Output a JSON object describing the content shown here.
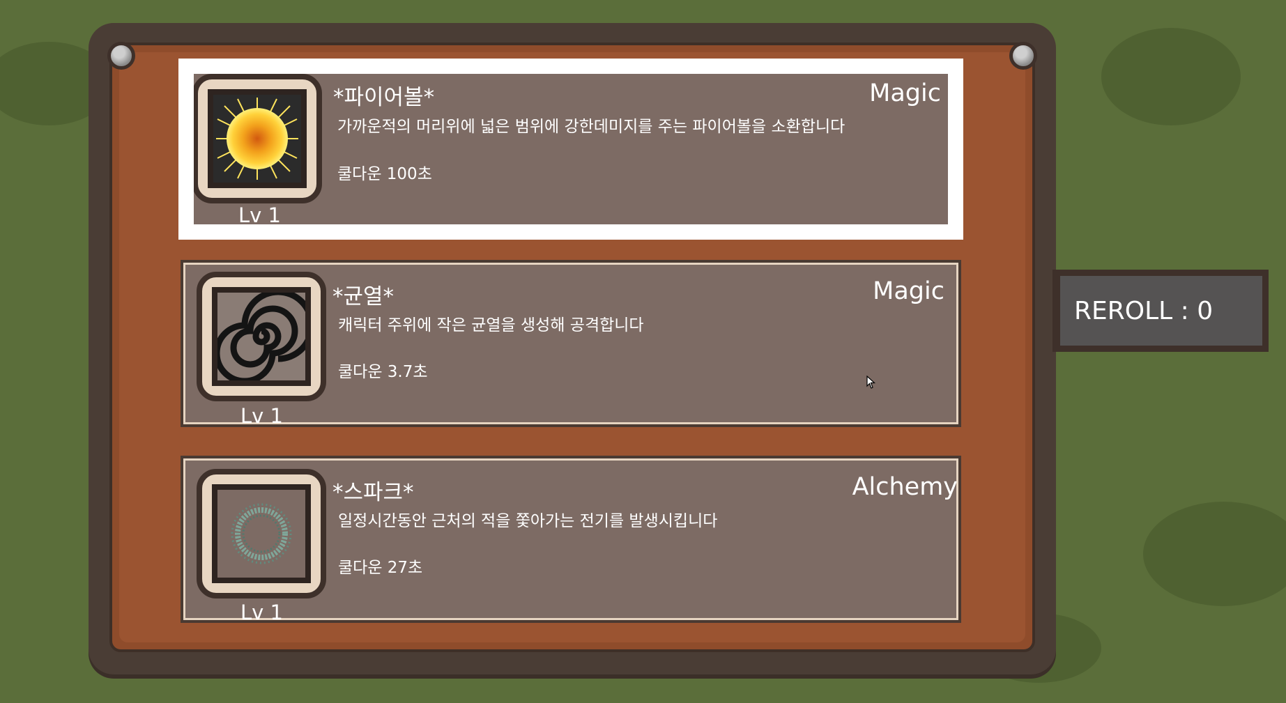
{
  "skills": [
    {
      "name": "*파이어볼*",
      "category": "Magic",
      "description": "가까운적의 머리위에 넓은 범위에 강한데미지를 주는 파이어볼을 소환합니다",
      "cooldown": "쿨다운 100초",
      "level": "Lv 1",
      "icon": "fireball-icon",
      "selected": true
    },
    {
      "name": "*균열*",
      "category": "Magic",
      "description": "캐릭터 주위에 작은 균열을 생성해 공격합니다",
      "cooldown": "쿨다운  3.7초",
      "level": "Lv 1",
      "icon": "spiral-rift-icon",
      "selected": false
    },
    {
      "name": "*스파크*",
      "category": "Alchemy",
      "description": "일정시간동안 근처의 적을 쫓아가는 전기를 발생시킵니다",
      "cooldown": "쿨다운  27초",
      "level": "Lv 1",
      "icon": "spark-ring-icon",
      "selected": false
    }
  ],
  "reroll": {
    "label": "REROLL : 0"
  },
  "colors": {
    "background": "#5b6e3a",
    "card": "#7d6b64",
    "selection_border": "#ffffff",
    "board": "#9b5431"
  }
}
